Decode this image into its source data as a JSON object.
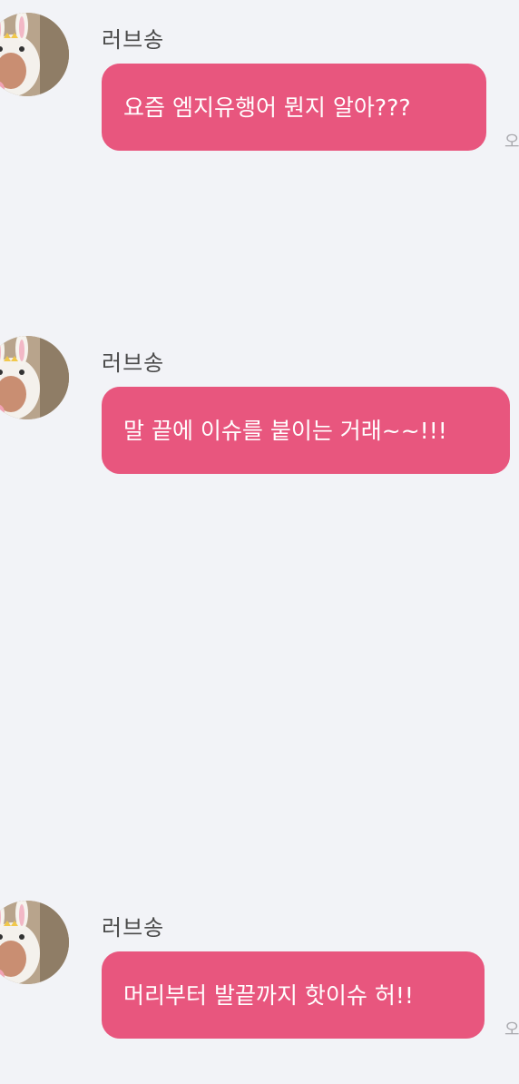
{
  "theme": {
    "background": "#f2f3f7",
    "bubble_color": "#e8567e",
    "bubble_text_color": "#ffffff"
  },
  "messages": [
    {
      "sender": "러브송",
      "avatar_icon": "bunny-hat-avatar",
      "text": "요즘 엠지유행어 뭔지 알아???",
      "time_partial": "오"
    },
    {
      "sender": "러브송",
      "avatar_icon": "bunny-hat-avatar",
      "text": "말 끝에 이슈를 붙이는 거래~~!!!",
      "time_partial": ""
    },
    {
      "sender": "러브송",
      "avatar_icon": "bunny-hat-avatar",
      "text": "머리부터 발끝까지 핫이슈 허!!",
      "time_partial": "오"
    }
  ]
}
